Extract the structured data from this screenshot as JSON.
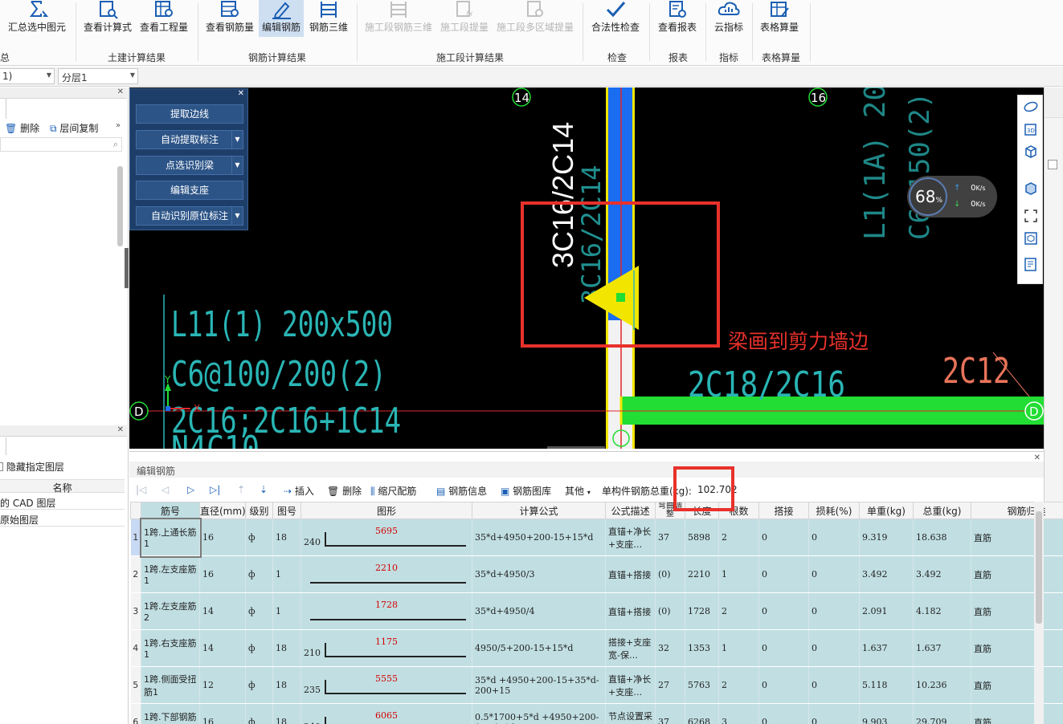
{
  "ribbon": {
    "buttons": [
      {
        "label": "汇总选中图元",
        "icon": "sum-icon"
      },
      {
        "label": "查看计算式",
        "icon": "formula-view-icon"
      },
      {
        "label": "查看工程量",
        "icon": "quantity-view-icon"
      },
      {
        "label": "查看钢筋量",
        "icon": "rebar-view-icon"
      },
      {
        "label": "编辑钢筋",
        "icon": "edit-rebar-icon",
        "active": true
      },
      {
        "label": "钢筋三维",
        "icon": "rebar-3d-icon"
      },
      {
        "label": "施工段钢筋三维",
        "icon": "stage-rebar-3d-icon",
        "disabled": true
      },
      {
        "label": "施工段提量",
        "icon": "stage-quantity-icon",
        "disabled": true
      },
      {
        "label": "施工段多区域提量",
        "icon": "stage-multi-quantity-icon",
        "disabled": true
      },
      {
        "label": "合法性检查",
        "icon": "check-icon"
      },
      {
        "label": "查看报表",
        "icon": "report-icon"
      },
      {
        "label": "云指标",
        "icon": "cloud-index-icon"
      },
      {
        "label": "表格算量",
        "icon": "table-calc-icon"
      }
    ],
    "groups": [
      "总",
      "土建计算结果",
      "钢筋计算结果",
      "施工段计算结果",
      "检查",
      "报表",
      "指标",
      "表格算量"
    ]
  },
  "combos": {
    "first": "1)",
    "second": "分层1"
  },
  "left_panel": {
    "delete_label": "删除",
    "copy_label": "层间复制",
    "hide_layer_label": "隐藏指定图层",
    "name_header": "名称",
    "layers": [
      "的 CAD 图层",
      "原始图层"
    ]
  },
  "float_panel": {
    "buttons": [
      {
        "label": "提取边线",
        "dropdown": false
      },
      {
        "label": "自动提取标注",
        "dropdown": true
      },
      {
        "label": "点选识别梁",
        "dropdown": true
      },
      {
        "label": "编辑支座",
        "dropdown": false
      },
      {
        "label": "自动识别原位标注",
        "dropdown": true
      }
    ]
  },
  "cad": {
    "axis_14": "14",
    "axis_16": "16",
    "axis_d": "D",
    "beam_vertical_white": "3C16/2C14",
    "beam_vertical_shadow": "3C16/2C14",
    "beam_main_1": "L11(1) 200x500",
    "beam_main_2": "C6@100/200(2)",
    "beam_main_3": "2C16;2C16+1C14",
    "beam_main_4": "N4C10",
    "right_bottom_1": "2C18/2C16",
    "right_bottom_2": "2C12",
    "right_top_1": "L1(1A) 200",
    "right_top_2": "C6@150(2)",
    "axis_x": "X",
    "axis_y": "Y",
    "annotation": "梁画到剪力墙边",
    "colors": {
      "annotation": "#e8312b",
      "box": "#e8312b",
      "cyan": "#2ab5b5",
      "green": "#22dd33",
      "blue": "#1a6cf0",
      "yellow": "#f2e600",
      "orange": "#e8735a"
    }
  },
  "monitor": {
    "percent": "68",
    "unit": "%",
    "up": "0",
    "down": "0",
    "rate_unit": "K/s"
  },
  "edit_panel": {
    "title": "编辑钢筋",
    "toolbar": {
      "insert": "插入",
      "delete": "删除",
      "scale": "缩尺配筋",
      "info": "钢筋信息",
      "library": "钢筋图库",
      "other": "其他",
      "total_label": "单构件钢筋总重(kg):",
      "total_value": "102.702"
    },
    "columns": [
      "筋号",
      "直径(mm)",
      "级别",
      "图号",
      "图形",
      "计算公式",
      "公式描述",
      "弯曲调整",
      "长度",
      "根数",
      "搭接",
      "损耗(%)",
      "单重(kg)",
      "总重(kg)",
      "钢筋归类"
    ],
    "rows": [
      {
        "no": "1",
        "name": "1跨.上通长筋1",
        "dia": "16",
        "grade": "ф",
        "fig": "18",
        "hook": "240",
        "shape": "5695",
        "formula": "35*d+4950+200-15+15*d",
        "desc": "直锚+净长+支座…",
        "bend": "37",
        "len": "5898",
        "count": "2",
        "lap": "0",
        "loss": "0",
        "unit": "9.319",
        "total": "18.638",
        "type": "直筋"
      },
      {
        "no": "2",
        "name": "1跨.左支座筋1",
        "dia": "16",
        "grade": "ф",
        "fig": "1",
        "hook": "",
        "shape": "2210",
        "formula": "35*d+4950/3",
        "desc": "直锚+搭接",
        "bend": "(0)",
        "len": "2210",
        "count": "1",
        "lap": "0",
        "loss": "0",
        "unit": "3.492",
        "total": "3.492",
        "type": "直筋"
      },
      {
        "no": "3",
        "name": "1跨.左支座筋2",
        "dia": "14",
        "grade": "ф",
        "fig": "1",
        "hook": "",
        "shape": "1728",
        "formula": "35*d+4950/4",
        "desc": "直锚+搭接",
        "bend": "(0)",
        "len": "1728",
        "count": "2",
        "lap": "0",
        "loss": "0",
        "unit": "2.091",
        "total": "4.182",
        "type": "直筋"
      },
      {
        "no": "4",
        "name": "1跨.右支座筋1",
        "dia": "14",
        "grade": "ф",
        "fig": "18",
        "hook": "210",
        "shape": "1175",
        "formula": "4950/5+200-15+15*d",
        "desc": "搭接+支座宽-保…",
        "bend": "32",
        "len": "1353",
        "count": "1",
        "lap": "0",
        "loss": "0",
        "unit": "1.637",
        "total": "1.637",
        "type": "直筋"
      },
      {
        "no": "5",
        "name": "1跨.侧面受扭筋1",
        "dia": "12",
        "grade": "ф",
        "fig": "18",
        "hook": "235",
        "shape": "5555",
        "formula": "35*d +4950+200-15+35*d-200+15",
        "desc": "直锚+净长+支座…",
        "bend": "27",
        "len": "5763",
        "count": "2",
        "lap": "0",
        "loss": "0",
        "unit": "5.118",
        "total": "10.236",
        "type": "直筋"
      },
      {
        "no": "6",
        "name": "1跨.下部钢筋1",
        "dia": "16",
        "grade": "ф",
        "fig": "18",
        "hook": "240",
        "shape": "6065",
        "formula": "0.5*1700+5*d +4950+200-15+15*d",
        "desc": "节点设置采用长…",
        "bend": "37",
        "len": "6268",
        "count": "3",
        "lap": "0",
        "loss": "0",
        "unit": "9.903",
        "total": "29.709",
        "type": "直筋"
      }
    ]
  }
}
